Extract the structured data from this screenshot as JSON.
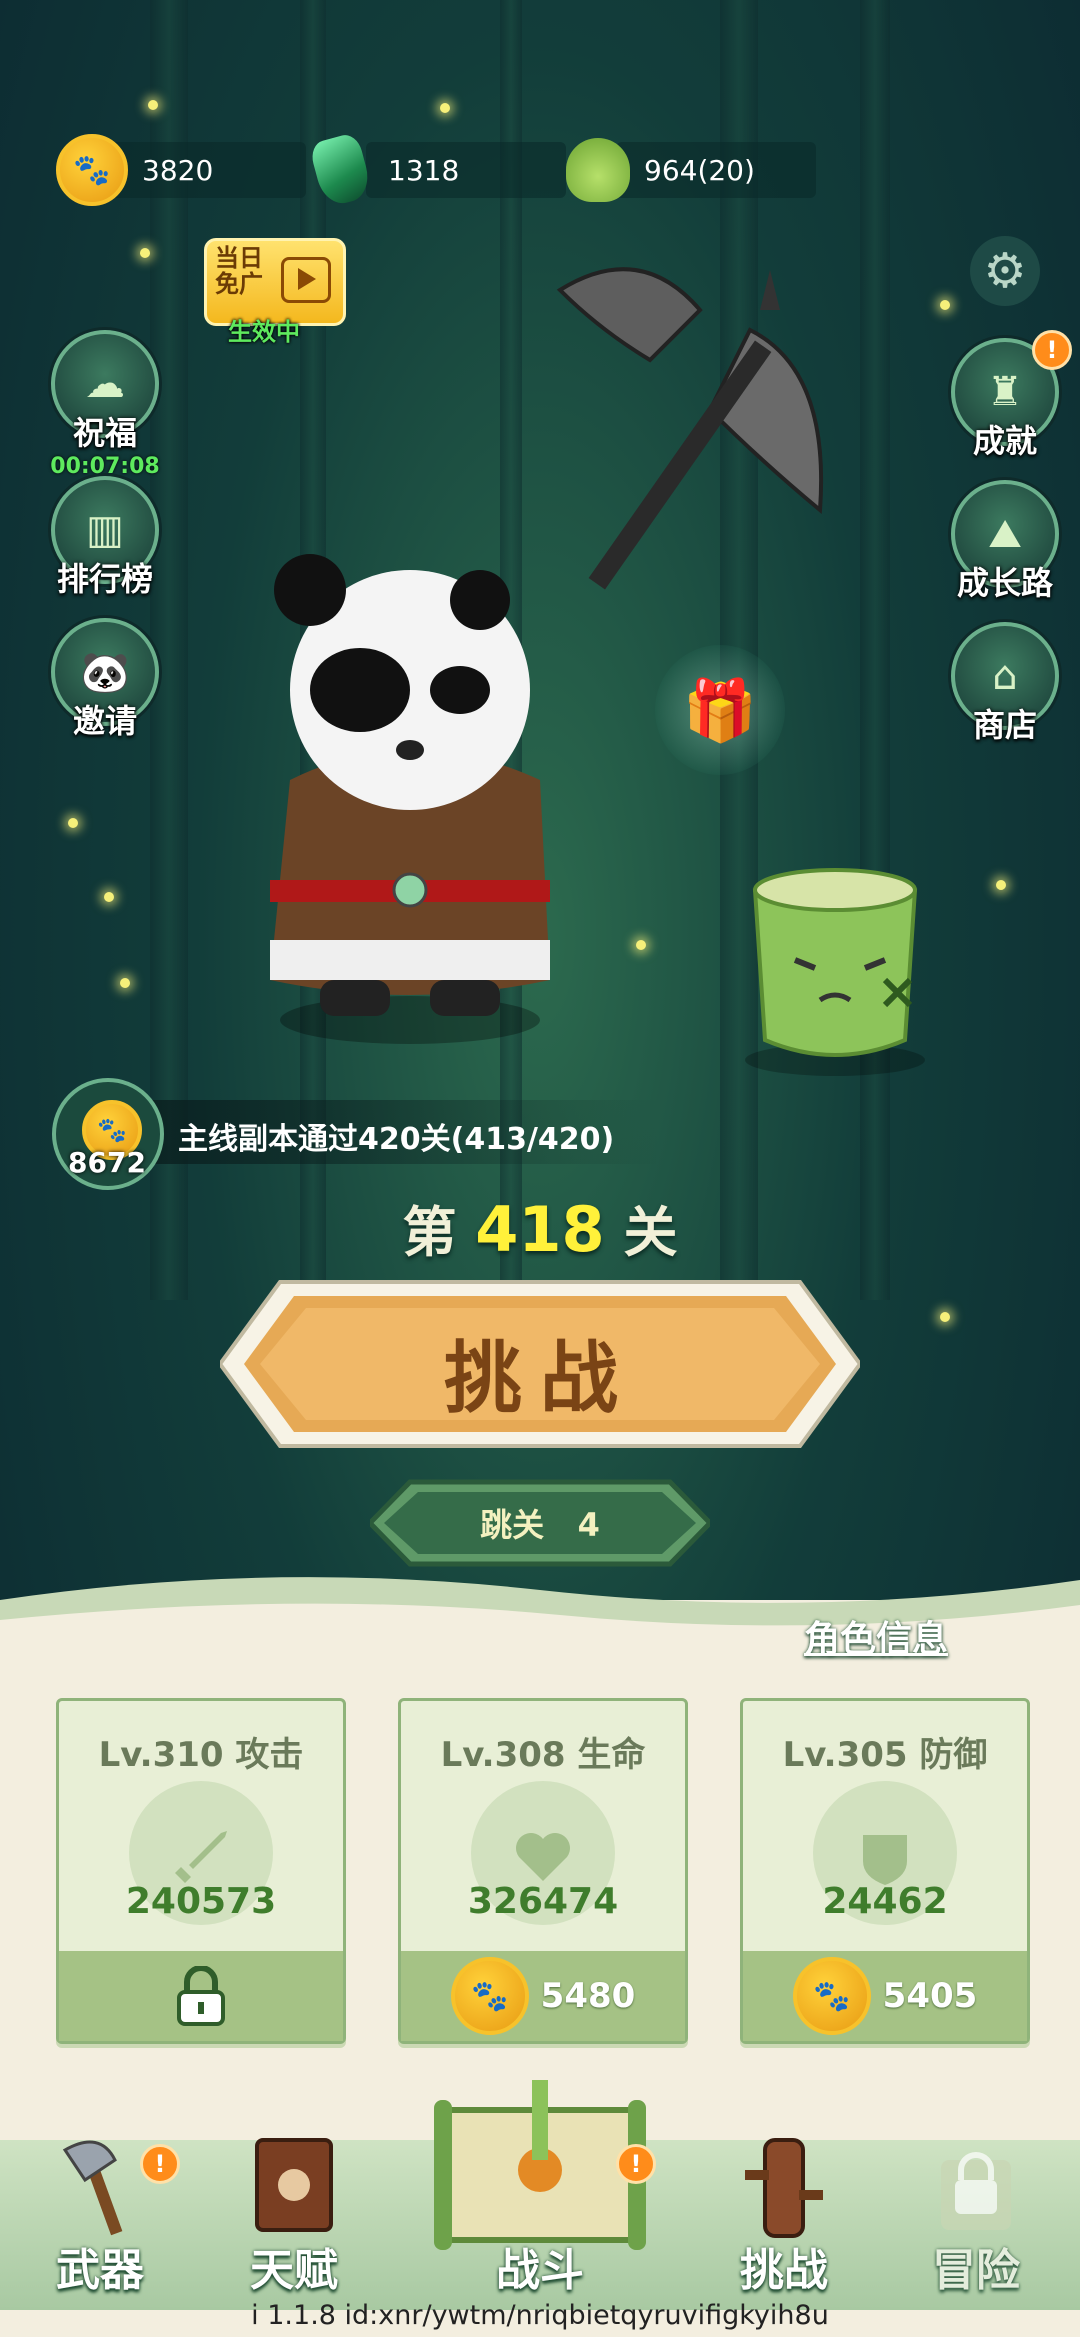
{
  "resources": {
    "paw_coins": "3820",
    "gems": "1318",
    "sprouts": "964(20)"
  },
  "free_ad": {
    "badge_text": "当日免广",
    "status": "生效中"
  },
  "left_buttons": [
    {
      "label": "祝福",
      "timer": "00:07:08"
    },
    {
      "label": "排行榜"
    },
    {
      "label": "邀请"
    }
  ],
  "right_buttons": [
    {
      "label": "成就",
      "badge": "!"
    },
    {
      "label": "成长路"
    },
    {
      "label": "商店"
    }
  ],
  "quest": {
    "coin_count": "8672",
    "text": "主线副本通过420关(413/420)"
  },
  "stage": {
    "prefix": "第",
    "number": "418",
    "suffix": "关"
  },
  "challenge_button": "挑战",
  "skip": {
    "label": "跳关",
    "count": "4"
  },
  "role_info_link": "角色信息",
  "stat_cards": [
    {
      "title": "Lv.310 攻击",
      "value": "240573",
      "cost": "",
      "locked": true,
      "icon": "sword-icon"
    },
    {
      "title": "Lv.308 生命",
      "value": "326474",
      "cost": "5480",
      "locked": false,
      "icon": "heart-icon"
    },
    {
      "title": "Lv.305 防御",
      "value": "24462",
      "cost": "5405",
      "locked": false,
      "icon": "shield-icon"
    }
  ],
  "nav": [
    {
      "label": "武器",
      "badge": "!"
    },
    {
      "label": "天赋"
    },
    {
      "label": "战斗",
      "badge": "!"
    },
    {
      "label": "挑战"
    },
    {
      "label": "冒险",
      "locked": true
    }
  ],
  "version_text": "i  1.1.8 id:xnr/ywtm/nriqbietqyruvifigkyih8u",
  "colors": {
    "accent_green": "#3f7d2c",
    "gold": "#f4b81e",
    "yellow_stage": "#fff13a"
  }
}
